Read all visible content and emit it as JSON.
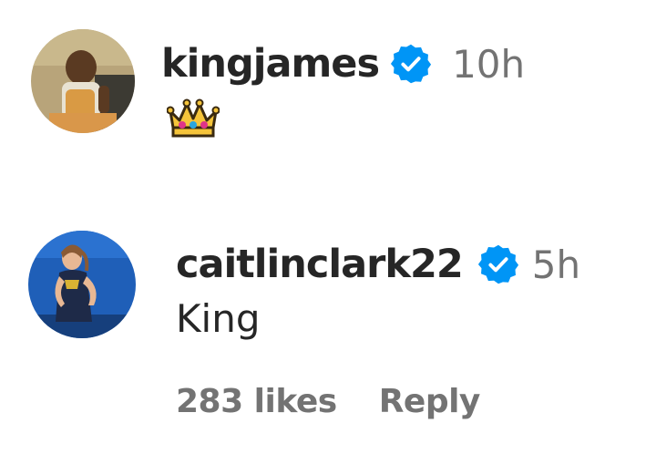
{
  "comments": [
    {
      "username": "kingjames",
      "verified": true,
      "time": "10h",
      "text": "",
      "emoji": "crown-emoji"
    },
    {
      "username": "caitlinclark22",
      "verified": true,
      "time": "5h",
      "text": "King",
      "likes": "283 likes",
      "reply_label": "Reply"
    }
  ],
  "colors": {
    "username": "#262626",
    "secondary": "#737373",
    "verified": "#0095f6"
  }
}
